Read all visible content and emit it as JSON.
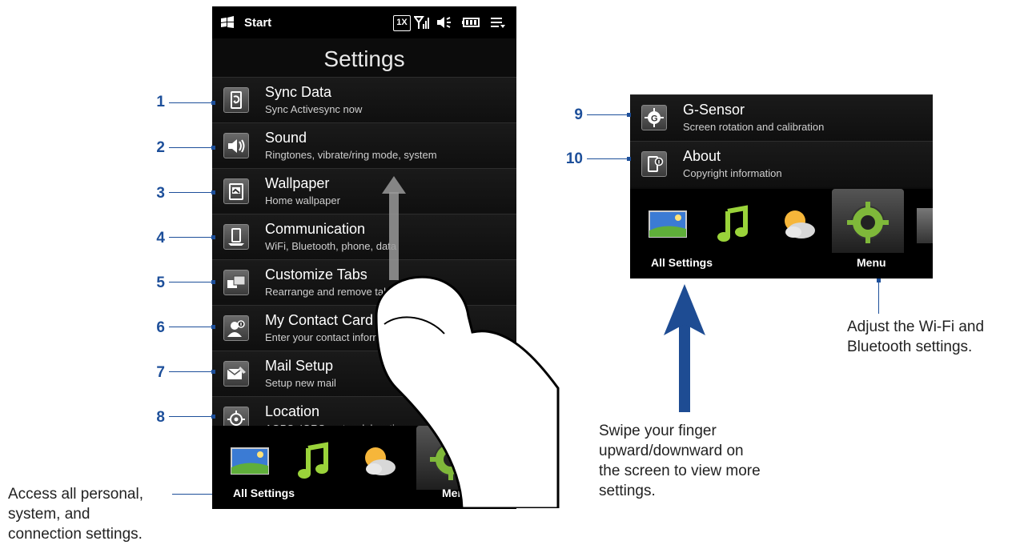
{
  "statusbar": {
    "start_label": "Start",
    "network_badge": "1X"
  },
  "screen_title": "Settings",
  "items": [
    {
      "title": "Sync Data",
      "subtitle": "Sync Activesync now",
      "icon": "sync-icon"
    },
    {
      "title": "Sound",
      "subtitle": "Ringtones, vibrate/ring mode, system",
      "icon": "speaker-icon"
    },
    {
      "title": "Wallpaper",
      "subtitle": "Home wallpaper",
      "icon": "wallpaper-icon"
    },
    {
      "title": "Communication",
      "subtitle": "WiFi, Bluetooth, phone, data",
      "icon": "communication-icon"
    },
    {
      "title": "Customize Tabs",
      "subtitle": "Rearrange and remove tabs",
      "icon": "tabs-icon"
    },
    {
      "title": "My Contact Card",
      "subtitle": "Enter your contact information",
      "icon": "contact-card-icon"
    },
    {
      "title": "Mail Setup",
      "subtitle": "Setup new mail",
      "icon": "mail-icon"
    },
    {
      "title": "Location",
      "subtitle": "AGPS, IQRS, network location",
      "icon": "location-icon"
    }
  ],
  "panel_items": [
    {
      "title": "G-Sensor",
      "subtitle": "Screen rotation and calibration",
      "icon": "g-sensor-icon"
    },
    {
      "title": "About",
      "subtitle": "Copyright information",
      "icon": "about-icon"
    }
  ],
  "tabbar": {
    "left_label": "All Settings",
    "right_label": "Menu"
  },
  "callouts": {
    "numbers": [
      "1",
      "2",
      "3",
      "4",
      "5",
      "6",
      "7",
      "8",
      "9",
      "10"
    ]
  },
  "captions": {
    "left": [
      "Access all personal,",
      "system, and",
      "connection settings."
    ],
    "middle": [
      "Swipe your finger",
      "upward/downward on",
      "the screen to view more",
      "settings."
    ],
    "right": [
      "Adjust the Wi-Fi and",
      "Bluetooth settings."
    ]
  },
  "colors": {
    "callout_blue": "#1d4f9a",
    "screen_background": "#0c0c0c",
    "swipe_arrow_blue": "#1e4c93"
  }
}
